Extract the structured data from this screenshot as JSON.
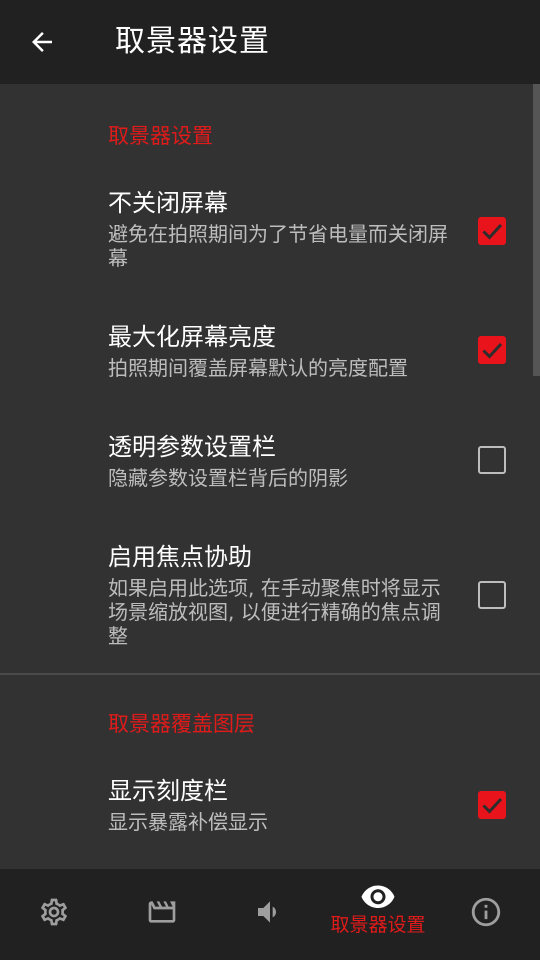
{
  "app_bar": {
    "back_icon": "arrow-left-icon",
    "title": "取景器设置"
  },
  "sections": [
    {
      "header": "取景器设置",
      "items": [
        {
          "title": "不关闭屏幕",
          "summary": "避免在拍照期间为了节省电量而关闭屏幕",
          "checked": true
        },
        {
          "title": "最大化屏幕亮度",
          "summary": "拍照期间覆盖屏幕默认的亮度配置",
          "checked": true
        },
        {
          "title": "透明参数设置栏",
          "summary": "隐藏参数设置栏背后的阴影",
          "checked": false
        },
        {
          "title": "启用焦点协助",
          "summary": "如果启用此选项, 在手动聚焦时将显示场景缩放视图, 以便进行精确的焦点调整",
          "checked": false
        }
      ]
    },
    {
      "header": "取景器覆盖图层",
      "items": [
        {
          "title": "显示刻度栏",
          "summary": "显示暴露补偿显示",
          "checked": true
        }
      ]
    }
  ],
  "bottom_nav": {
    "items": [
      {
        "icon": "gear-icon",
        "active": false
      },
      {
        "icon": "clapperboard-icon",
        "active": false
      },
      {
        "icon": "volume-icon",
        "active": false
      },
      {
        "icon": "eye-icon",
        "active": true,
        "label": "取景器设置"
      },
      {
        "icon": "info-icon",
        "active": false
      }
    ]
  },
  "colors": {
    "accent": "#e8131b",
    "accent_text": "#e11a1a",
    "content_bg": "#323232",
    "bar_bg": "#212121",
    "summary_text": "#bdbdbd",
    "icon_gray": "#9e9e9e"
  }
}
